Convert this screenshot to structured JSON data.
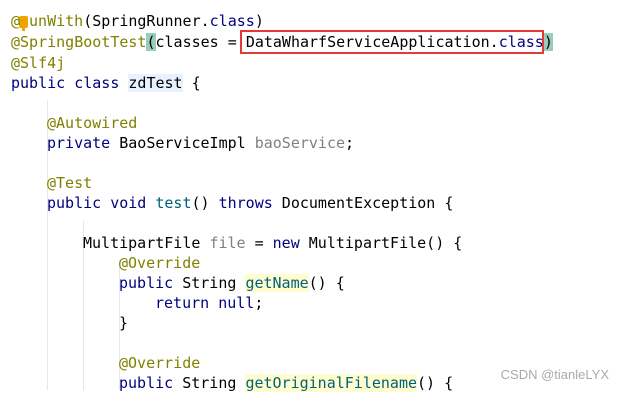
{
  "code": {
    "l1": {
      "at": "@",
      "ann_rest": "unWith",
      "rest": "(SpringRunner.",
      "kw": "class",
      "close": ")"
    },
    "l2": {
      "ann": "@SpringBootTest",
      "open_paren": "(",
      "arg": "classes = ",
      "cls": "DataWharfServiceApplication.",
      "kw": "class",
      "close_paren": ")"
    },
    "l3": {
      "ann": "@Slf4j"
    },
    "l4": {
      "kw1": "public",
      "kw2": "class",
      "name": "zdTest",
      "brace": " {"
    },
    "l5": {
      "ann": "@Autowired"
    },
    "l6": {
      "kw": "private",
      "type": " BaoServiceImpl ",
      "field": "baoService",
      "semi": ";"
    },
    "l7": {
      "ann": "@Test"
    },
    "l8": {
      "kw1": "public",
      "kw2": "void",
      "method": "test",
      "paren": "()",
      "kw3": "throws",
      "exc": " DocumentException {"
    },
    "l9": {
      "type": "MultipartFile ",
      "var": "file",
      "eq": " = ",
      "kw": "new",
      "ctor": " MultipartFile() {"
    },
    "l10": {
      "ann": "@Override"
    },
    "l11": {
      "kw": "public",
      "type": " String ",
      "method": "getName",
      "rest": "() {"
    },
    "l12": {
      "kw": "return",
      "val": "null",
      "semi": ";"
    },
    "l13": {
      "brace": "}"
    },
    "l14": {
      "ann": "@Override"
    },
    "l15": {
      "kw": "public",
      "type": " String ",
      "method": "getOriginalFilename",
      "rest": "() {"
    }
  },
  "watermark": "CSDN @tianleLYX",
  "colors": {
    "annotation": "#808000",
    "keyword": "#000080",
    "field": "#808080",
    "highlight_box": "#e53935"
  }
}
